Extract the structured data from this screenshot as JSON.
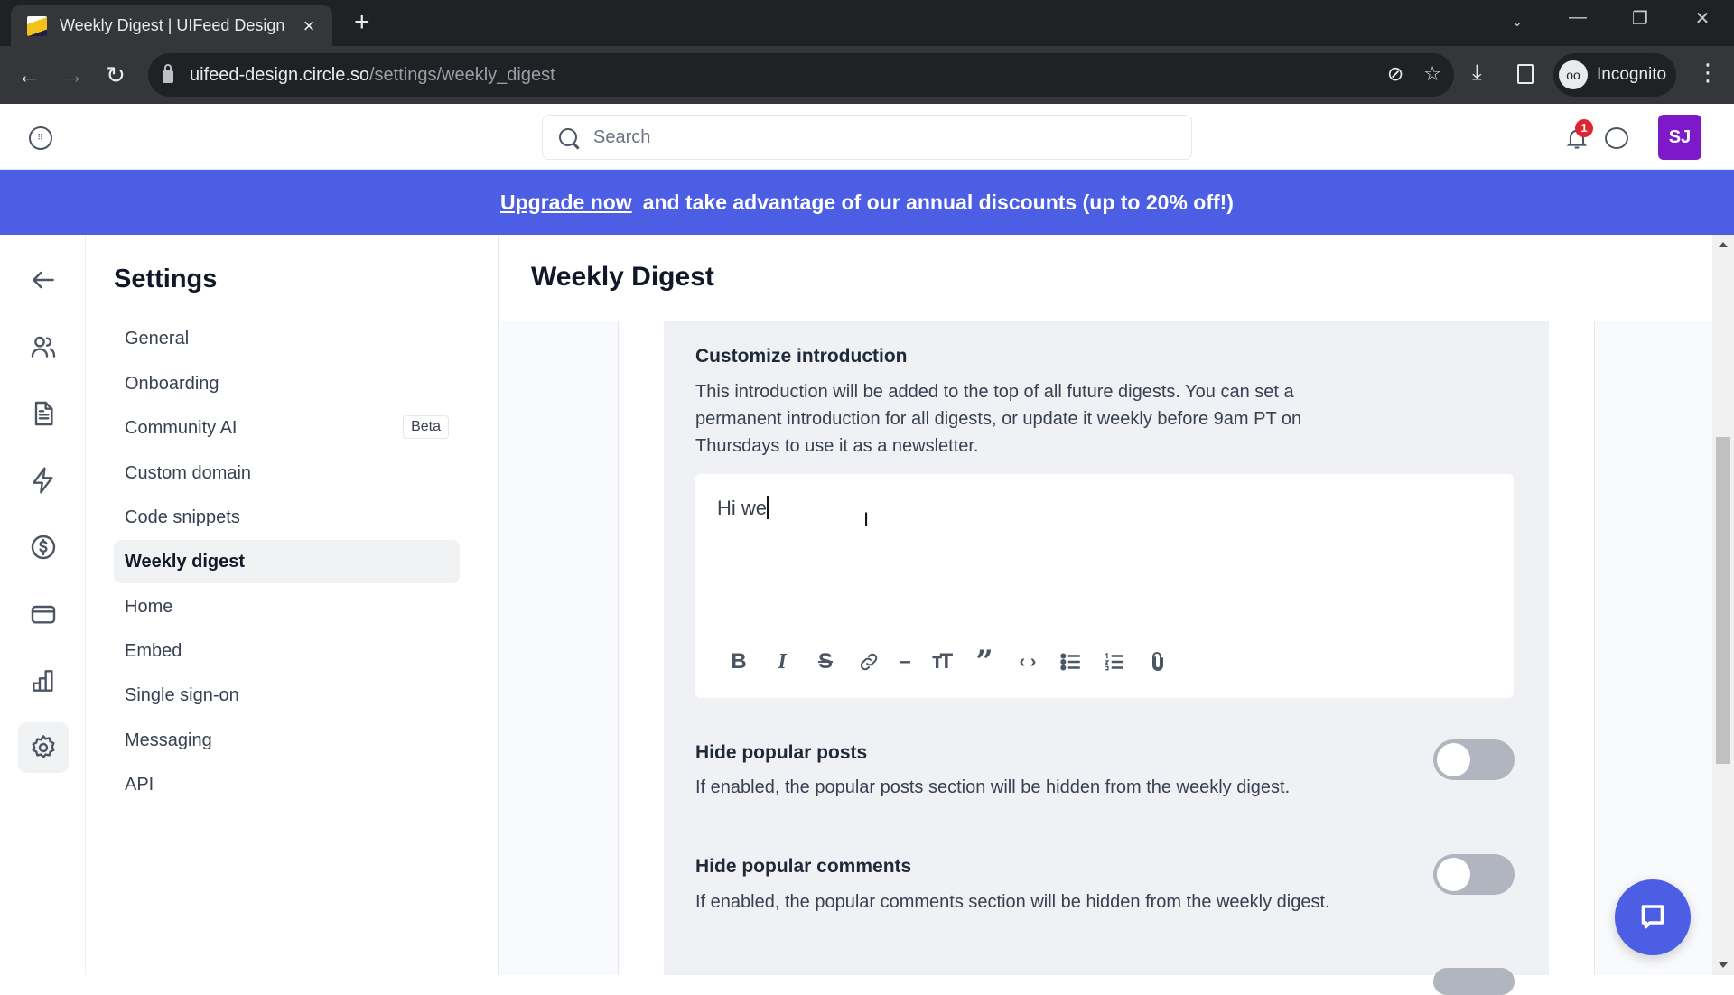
{
  "browser": {
    "tab_title": "Weekly Digest | UIFeed Design",
    "tab_close": "×",
    "new_tab": "+",
    "url_host": "uifeed-design.circle.so",
    "url_path": "/settings/weekly_digest",
    "incognito_label": "Incognito",
    "window_controls": {
      "dropdown": "⌄",
      "minimize": "—",
      "restore": "❐",
      "close": "✕"
    }
  },
  "header": {
    "search_placeholder": "Search",
    "notification_count": "1",
    "avatar_initials": "SJ",
    "avatar_color": "#7e19c9"
  },
  "banner": {
    "link_text": "Upgrade now",
    "message": "and take advantage of our annual discounts (up to 20% off!)",
    "color": "#4b5ee4"
  },
  "rail": {
    "icons": [
      "back-arrow-icon",
      "members-icon",
      "document-icon",
      "lightning-icon",
      "dollar-icon",
      "credit-card-icon",
      "analytics-icon",
      "settings-gear-icon"
    ],
    "active": "settings-gear-icon"
  },
  "settings_nav": {
    "title": "Settings",
    "items": [
      {
        "label": "General"
      },
      {
        "label": "Onboarding"
      },
      {
        "label": "Community AI",
        "badge": "Beta"
      },
      {
        "label": "Custom domain"
      },
      {
        "label": "Code snippets"
      },
      {
        "label": "Weekly digest",
        "active": true
      },
      {
        "label": "Home"
      },
      {
        "label": "Embed"
      },
      {
        "label": "Single sign-on"
      },
      {
        "label": "Messaging"
      },
      {
        "label": "API"
      }
    ]
  },
  "main": {
    "title": "Weekly Digest",
    "intro": {
      "title": "Customize introduction",
      "description": "This introduction will be added to the top of all future digests. You can set a permanent introduction for all digests, or update it weekly before 9am PT on Thursdays to use it as a newsletter.",
      "editor_value": "Hi we",
      "toolbar": [
        "B",
        "I",
        "S",
        "link",
        "–",
        "TT",
        "❞",
        "‹›",
        "bullets",
        "numbers",
        "attach"
      ]
    },
    "toggles": [
      {
        "title": "Hide popular posts",
        "description": "If enabled, the popular posts section will be hidden from the weekly digest.",
        "enabled": false
      },
      {
        "title": "Hide popular comments",
        "description": "If enabled, the popular comments section will be hidden from the weekly digest.",
        "enabled": false
      }
    ]
  }
}
